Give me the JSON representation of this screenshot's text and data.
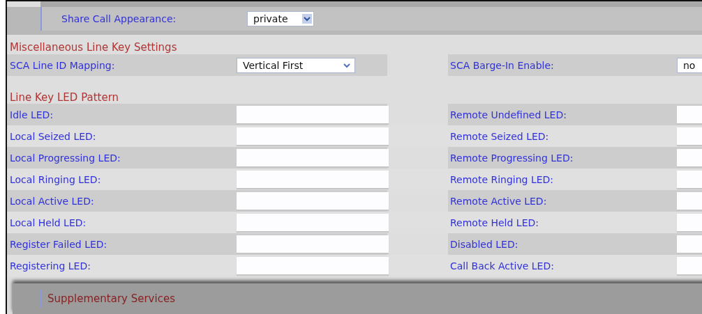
{
  "share_call_appearance": {
    "label": "Share Call Appearance:",
    "value": "private"
  },
  "misc": {
    "title": "Miscellaneous Line Key Settings",
    "fields": [
      {
        "label": "SCA Line ID Mapping:",
        "value": "Vertical First"
      },
      {
        "label": "SCA Barge-In Enable:",
        "value": "no"
      }
    ]
  },
  "led": {
    "title": "Line Key LED Pattern",
    "rows": [
      {
        "left": "Idle LED:",
        "right": "Remote Undefined LED:"
      },
      {
        "left": "Local Seized LED:",
        "right": "Remote Seized LED:"
      },
      {
        "left": "Local Progressing LED:",
        "right": "Remote Progressing LED:"
      },
      {
        "left": "Local Ringing LED:",
        "right": "Remote Ringing LED:"
      },
      {
        "left": "Local Active LED:",
        "right": "Remote Active LED:"
      },
      {
        "left": "Local Held LED:",
        "right": "Remote Held LED:"
      },
      {
        "left": "Register Failed LED:",
        "right": "Disabled LED:"
      },
      {
        "left": "Registering LED:",
        "right": "Call Back Active LED:"
      }
    ]
  },
  "next_section": {
    "title": "Supplementary Services"
  }
}
